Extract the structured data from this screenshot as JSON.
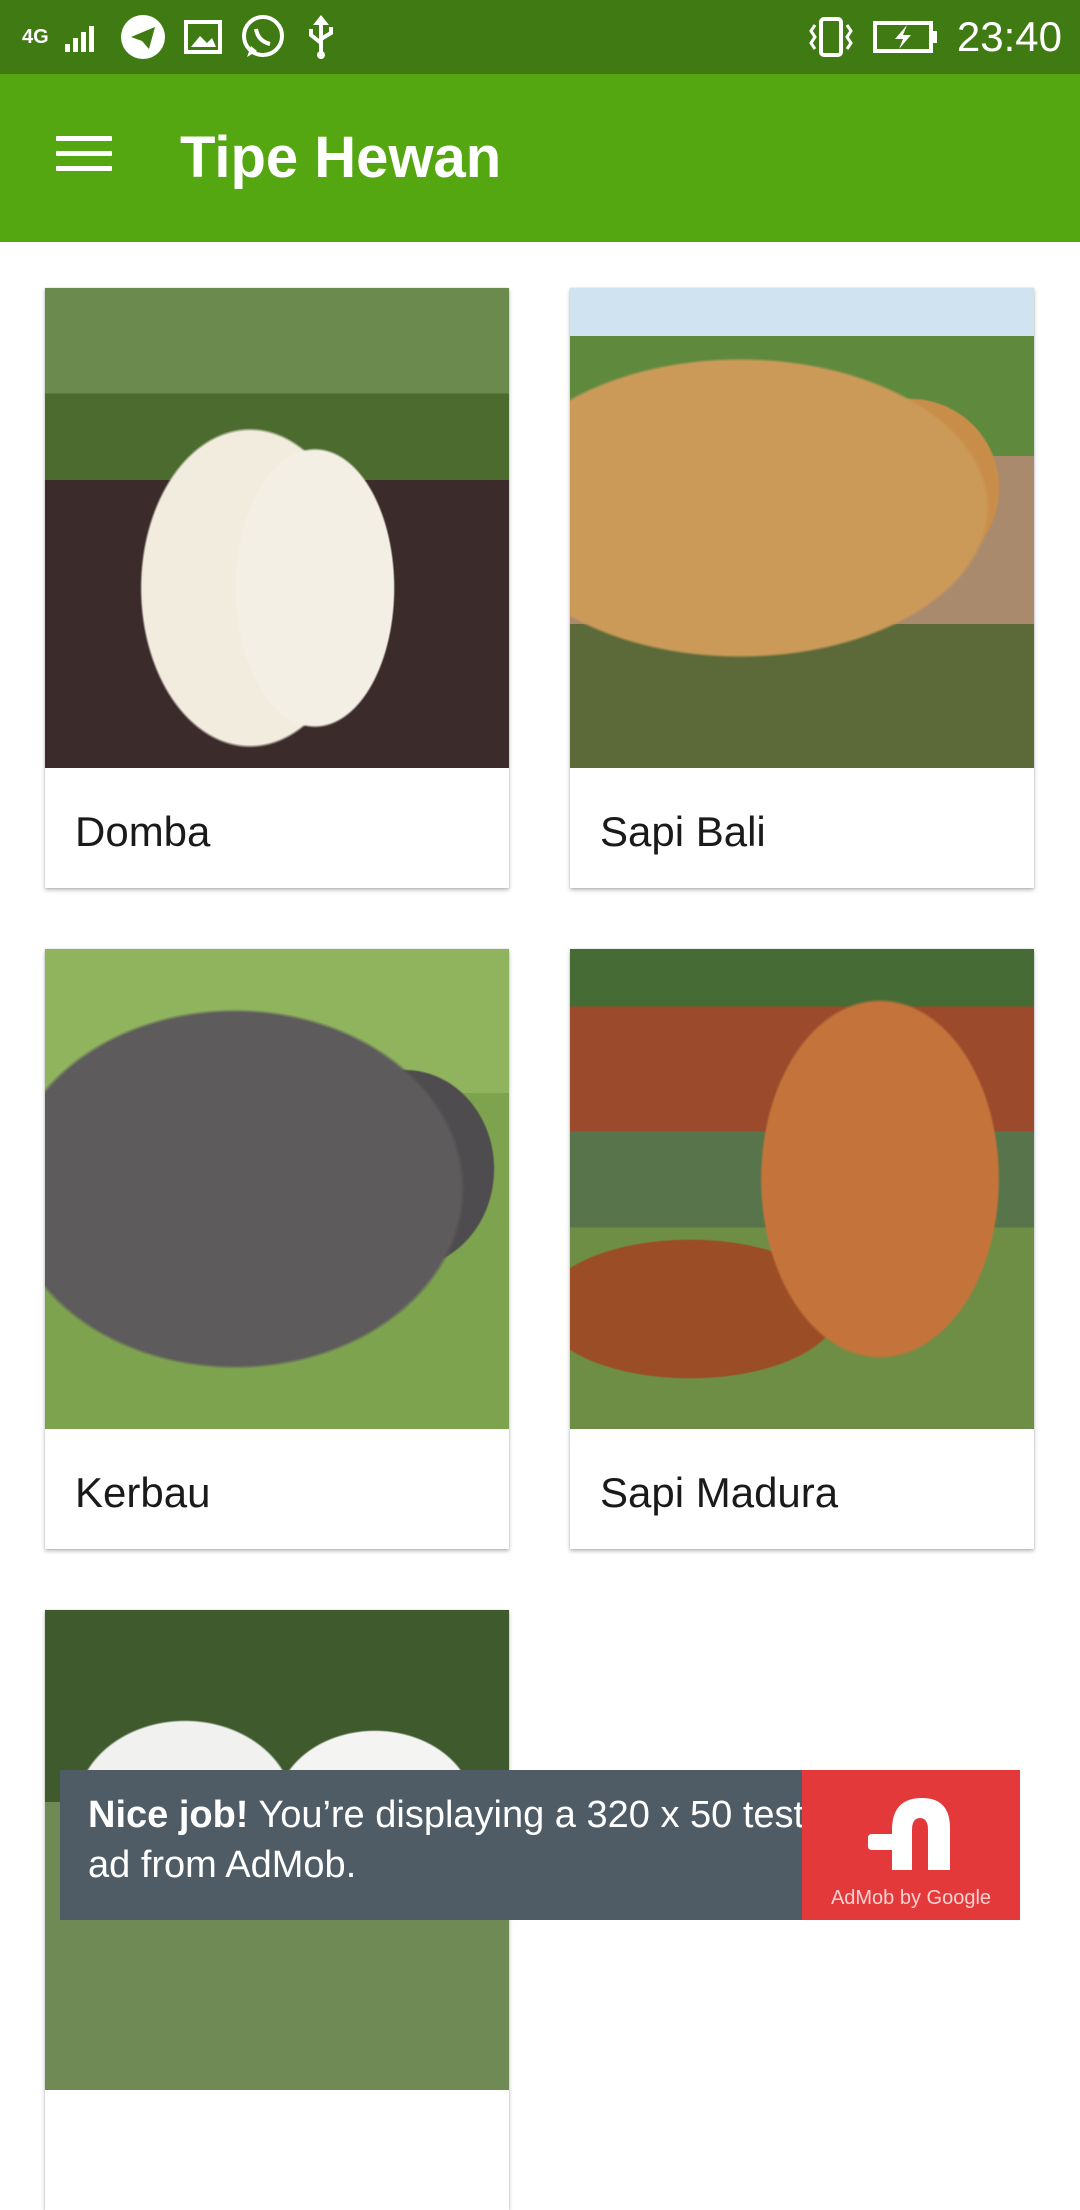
{
  "status_bar": {
    "network": "4G",
    "time": "23:40"
  },
  "app_bar": {
    "title": "Tipe Hewan"
  },
  "cards": [
    {
      "label": "Domba"
    },
    {
      "label": "Sapi Bali"
    },
    {
      "label": "Kerbau"
    },
    {
      "label": "Sapi Madura"
    },
    {
      "label": ""
    }
  ],
  "ad": {
    "headline": "Nice job!",
    "body": " You’re displaying a 320 x 50 test ad from AdMob.",
    "brand": "AdMob by Google"
  },
  "colors": {
    "status_bar": "#3f7a12",
    "app_bar": "#55a711",
    "ad_background": "#4f5c66",
    "ad_logo": "#e4393a"
  }
}
